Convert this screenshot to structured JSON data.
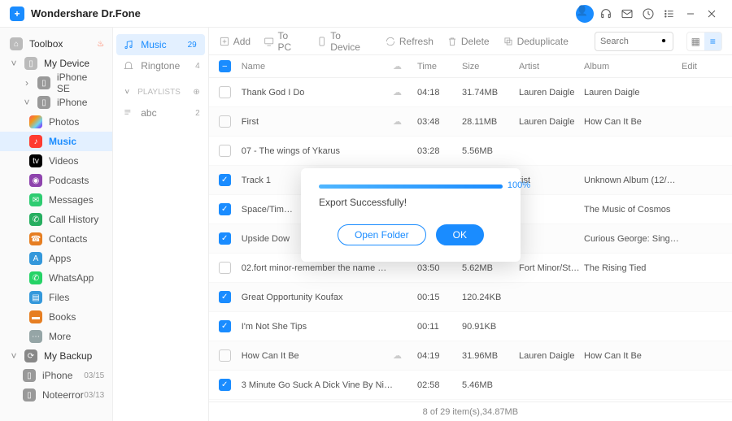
{
  "app": {
    "title": "Wondershare Dr.Fone"
  },
  "sidebar": {
    "toolbox": "Toolbox",
    "mydevice": "My Device",
    "iphone_se": "iPhone SE",
    "iphone": "iPhone",
    "photos": "Photos",
    "music": "Music",
    "videos": "Videos",
    "podcasts": "Podcasts",
    "messages": "Messages",
    "call_history": "Call History",
    "contacts": "Contacts",
    "apps": "Apps",
    "whatsapp": "WhatsApp",
    "files": "Files",
    "books": "Books",
    "more": "More",
    "mybackup": "My Backup",
    "bak1": "iPhone",
    "bak1_date": "03/15",
    "bak2": "Noteerror",
    "bak2_date": "03/13"
  },
  "panel2": {
    "music": "Music",
    "music_count": "29",
    "ringtone": "Ringtone",
    "ringtone_count": "4",
    "playlists": "PLAYLISTS",
    "abc": "abc",
    "abc_count": "2"
  },
  "toolbar": {
    "add": "Add",
    "topc": "To PC",
    "todev": "To Device",
    "refresh": "Refresh",
    "delete": "Delete",
    "dedup": "Deduplicate",
    "search_ph": "Search"
  },
  "headers": {
    "name": "Name",
    "time": "Time",
    "size": "Size",
    "artist": "Artist",
    "album": "Album",
    "edit": "Edit"
  },
  "rows": [
    {
      "chk": false,
      "name": "Thank God I Do",
      "cloud": true,
      "time": "04:18",
      "size": "31.74MB",
      "artist": "Lauren Daigle",
      "album": "Lauren Daigle"
    },
    {
      "chk": false,
      "name": "First",
      "cloud": true,
      "time": "03:48",
      "size": "28.11MB",
      "artist": "Lauren Daigle",
      "album": "How Can It Be"
    },
    {
      "chk": false,
      "name": "07 - The wings of Ykarus",
      "cloud": false,
      "time": "03:28",
      "size": "5.56MB",
      "artist": "",
      "album": ""
    },
    {
      "chk": true,
      "name": "Track 1",
      "cloud": false,
      "time": "",
      "size": "",
      "artist": "tist",
      "album": "Unknown Album (12/…"
    },
    {
      "chk": true,
      "name": "Space/Tim…",
      "cloud": false,
      "time": "",
      "size": "",
      "artist": "",
      "album": "The Music of Cosmos"
    },
    {
      "chk": true,
      "name": "Upside Dow",
      "cloud": false,
      "time": "",
      "size": "",
      "artist": "",
      "album": "Curious George: Sing-…"
    },
    {
      "chk": false,
      "name": "02.fort minor-remember the name …",
      "cloud": false,
      "time": "03:50",
      "size": "5.62MB",
      "artist": "Fort Minor/Styl…",
      "album": "The Rising Tied"
    },
    {
      "chk": true,
      "name": "Great Opportunity Koufax",
      "cloud": false,
      "time": "00:15",
      "size": "120.24KB",
      "artist": "",
      "album": ""
    },
    {
      "chk": true,
      "name": "I'm Not She Tips",
      "cloud": false,
      "time": "00:11",
      "size": "90.91KB",
      "artist": "",
      "album": ""
    },
    {
      "chk": false,
      "name": "How Can It Be",
      "cloud": true,
      "time": "04:19",
      "size": "31.96MB",
      "artist": "Lauren Daigle",
      "album": "How Can It Be"
    },
    {
      "chk": true,
      "name": "3 Minute Go Suck A Dick Vine By Ni…",
      "cloud": false,
      "time": "02:58",
      "size": "5.46MB",
      "artist": "",
      "album": ""
    }
  ],
  "footer": "8 of 29 item(s),34.87MB",
  "modal": {
    "pct": "100%",
    "msg": "Export Successfully!",
    "open": "Open Folder",
    "ok": "OK"
  }
}
